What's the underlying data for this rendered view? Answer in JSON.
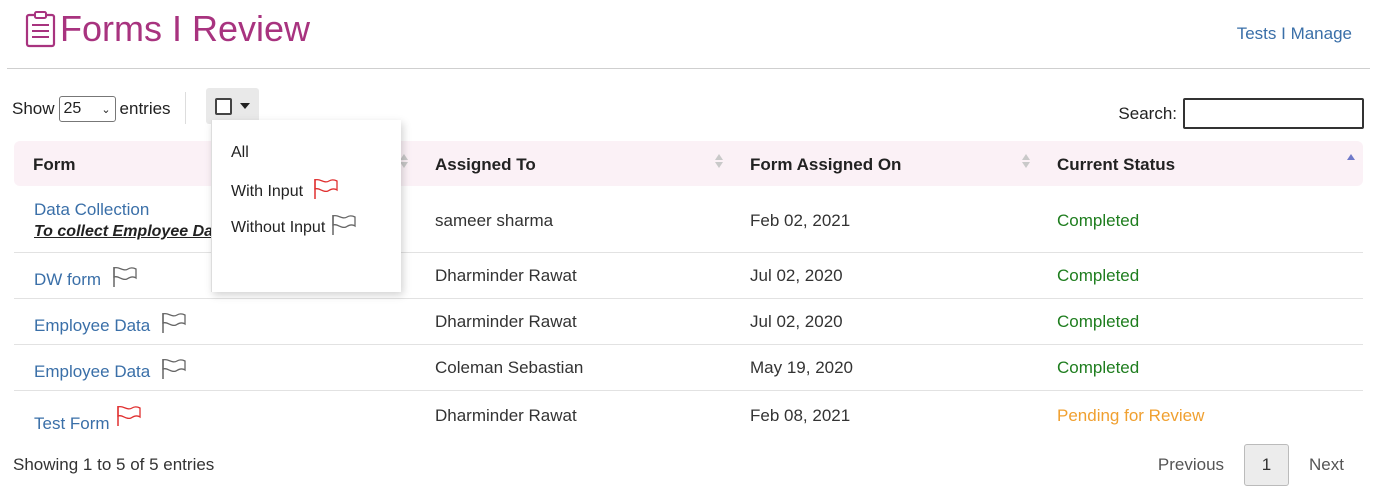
{
  "header": {
    "title": "Forms I Review",
    "title_icon": "clipboard-icon",
    "manage_link": "Tests I Manage",
    "accent_color": "#a8337f",
    "link_color": "#3a6fa8"
  },
  "controls": {
    "show_label": "Show",
    "page_length": "25",
    "entries_label": "entries",
    "search_label": "Search:",
    "search_value": ""
  },
  "filter_menu": {
    "items": [
      {
        "label": "All",
        "icon": ""
      },
      {
        "label": "With Input",
        "icon": "red-flag-icon"
      },
      {
        "label": "Without Input",
        "icon": "gray-flag-icon"
      }
    ]
  },
  "table": {
    "columns": [
      "Form",
      "Assigned To",
      "Form Assigned On",
      "Current Status"
    ],
    "rows": [
      {
        "form": "Data Collection",
        "subtitle": "To collect Employee Data",
        "flag": "",
        "assigned_to": "sameer sharma",
        "assigned_on": "Feb 02, 2021",
        "status": "Completed"
      },
      {
        "form": "DW form",
        "subtitle": "",
        "flag": "gray",
        "assigned_to": "Dharminder Rawat",
        "assigned_on": "Jul 02, 2020",
        "status": "Completed"
      },
      {
        "form": "Employee Data",
        "subtitle": "",
        "flag": "gray",
        "assigned_to": "Dharminder Rawat",
        "assigned_on": "Jul 02, 2020",
        "status": "Completed"
      },
      {
        "form": "Employee Data",
        "subtitle": "",
        "flag": "gray",
        "assigned_to": "Coleman Sebastian",
        "assigned_on": "May 19, 2020",
        "status": "Completed"
      },
      {
        "form": "Test Form",
        "subtitle": "",
        "flag": "red",
        "assigned_to": "Dharminder Rawat",
        "assigned_on": "Feb 08, 2021",
        "status": "Pending for Review"
      }
    ]
  },
  "footer": {
    "info": "Showing 1 to 5 of 5 entries",
    "previous": "Previous",
    "current_page": "1",
    "next": "Next"
  },
  "colors": {
    "completed": "#1e7d1e",
    "pending": "#f0a030",
    "red_flag": "#e03030"
  }
}
